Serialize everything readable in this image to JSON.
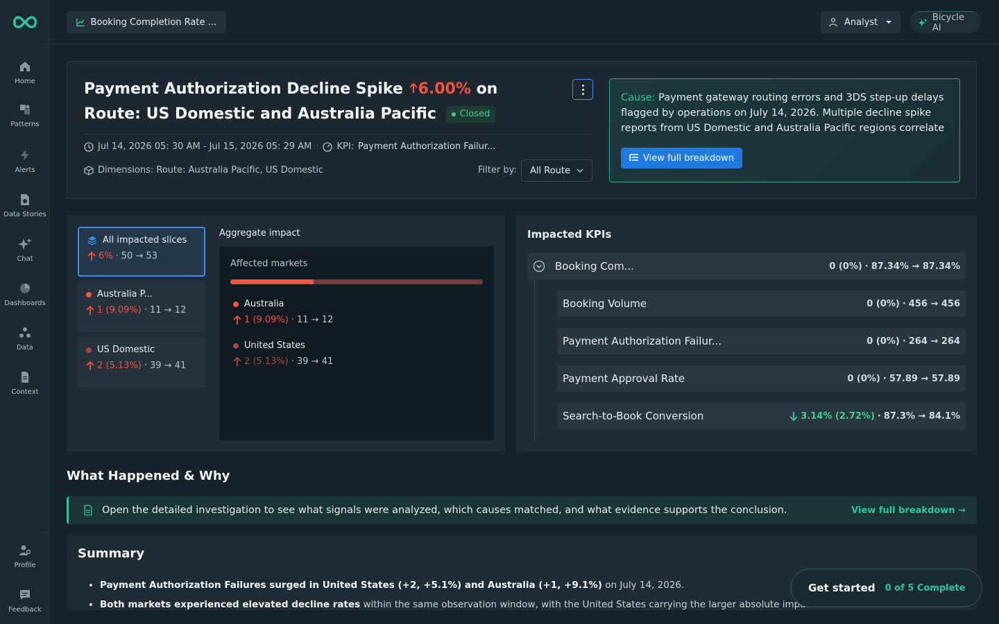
{
  "app": {
    "accent": "#2ec4a0",
    "danger": "#f0533f",
    "primary": "#1f7ae0"
  },
  "sidebar": {
    "items": [
      {
        "label": "Home",
        "icon": "home-icon"
      },
      {
        "label": "Patterns",
        "icon": "patterns-icon"
      },
      {
        "label": "Alerts",
        "icon": "bolt-icon"
      },
      {
        "label": "Data Stories",
        "icon": "document-icon"
      },
      {
        "label": "Chat",
        "icon": "sparkle-icon"
      },
      {
        "label": "Dashboards",
        "icon": "pie-icon"
      },
      {
        "label": "Data",
        "icon": "data-icon"
      },
      {
        "label": "Context",
        "icon": "page-icon"
      }
    ],
    "bottom": [
      {
        "label": "Profile",
        "icon": "profile-gear-icon"
      },
      {
        "label": "Feedback",
        "icon": "feedback-icon"
      }
    ]
  },
  "topbar": {
    "page_title": "Booking Completion Rate ...",
    "role": "Analyst",
    "ai_label": "Bicycle AI"
  },
  "alert": {
    "title_part1": "Payment Authorization Decline Spike",
    "change": "6.00%",
    "title_part2": "on Route: US Domestic and Australia Pacific",
    "status": "Closed",
    "time_range": "Jul 14, 2026 05: 30 AM - Jul 15, 2026 05: 29 AM",
    "kpi_label": "KPI:",
    "kpi_value": "Payment Authorization Failur...",
    "dimensions": "Dimensions: Route: Australia Pacific, US Domestic",
    "filter_label": "Filter by:",
    "filter_value": "All Route"
  },
  "cause": {
    "label": "Cause:",
    "text": "Payment gateway routing errors and 3DS step-up delays flagged by operations on July 14, 2026. Multiple decline spike reports from US Domestic and Australia Pacific regions correlate",
    "button": "View full breakdown"
  },
  "slices": [
    {
      "title": "All impacted slices",
      "change": "6%",
      "range": "50 → 53"
    },
    {
      "title": "Australia P...",
      "change": "1 (9.09%)",
      "range": "11 → 12",
      "color": "#f0533f"
    },
    {
      "title": "US Domestic",
      "change": "2 (5.13%)",
      "range": "39 → 41",
      "color": "#a24a46"
    }
  ],
  "aggregate": {
    "label": "Aggregate impact",
    "sub_label": "Affected markets",
    "share_first": 0.33,
    "markets": [
      {
        "name": "Australia",
        "change": "1 (9.09%)",
        "range": "11 → 12"
      },
      {
        "name": "United States",
        "change": "2 (5.13%)",
        "range": "39 → 41"
      }
    ]
  },
  "kpis": {
    "heading": "Impacted KPIs",
    "parent": {
      "name": "Booking Com...",
      "change": "0 (0%)",
      "range": "87.34% → 87.34%"
    },
    "children": [
      {
        "name": "Booking Volume",
        "change": "0 (0%)",
        "range": "456 → 456"
      },
      {
        "name": "Payment Authorization Failur...",
        "change": "0 (0%)",
        "range": "264 → 264"
      },
      {
        "name": "Payment Approval Rate",
        "change": "0 (0%)",
        "range": "57.89 → 57.89"
      },
      {
        "name": "Search-to-Book Conversion",
        "change": "3.14% (2.72%)",
        "range": "87.3% → 84.1%"
      }
    ]
  },
  "what_happened": {
    "title": "What Happened & Why",
    "banner_text": "Open the detailed investigation to see what signals were analyzed, which causes matched, and what evidence supports the conclusion.",
    "banner_link": "View full breakdown →"
  },
  "summary": {
    "title": "Summary",
    "items": [
      {
        "bold": "Payment Authorization Failures surged in United States (+2, +5.1%) and Australia (+1, +9.1%)",
        "rest": " on July 14, 2026."
      },
      {
        "bold": "Both markets experienced elevated decline rates",
        "rest": " within the same observation window, with the United States carrying the larger absolute impact."
      }
    ]
  },
  "get_started": {
    "label": "Get started",
    "progress": "0 of 5 Complete"
  }
}
